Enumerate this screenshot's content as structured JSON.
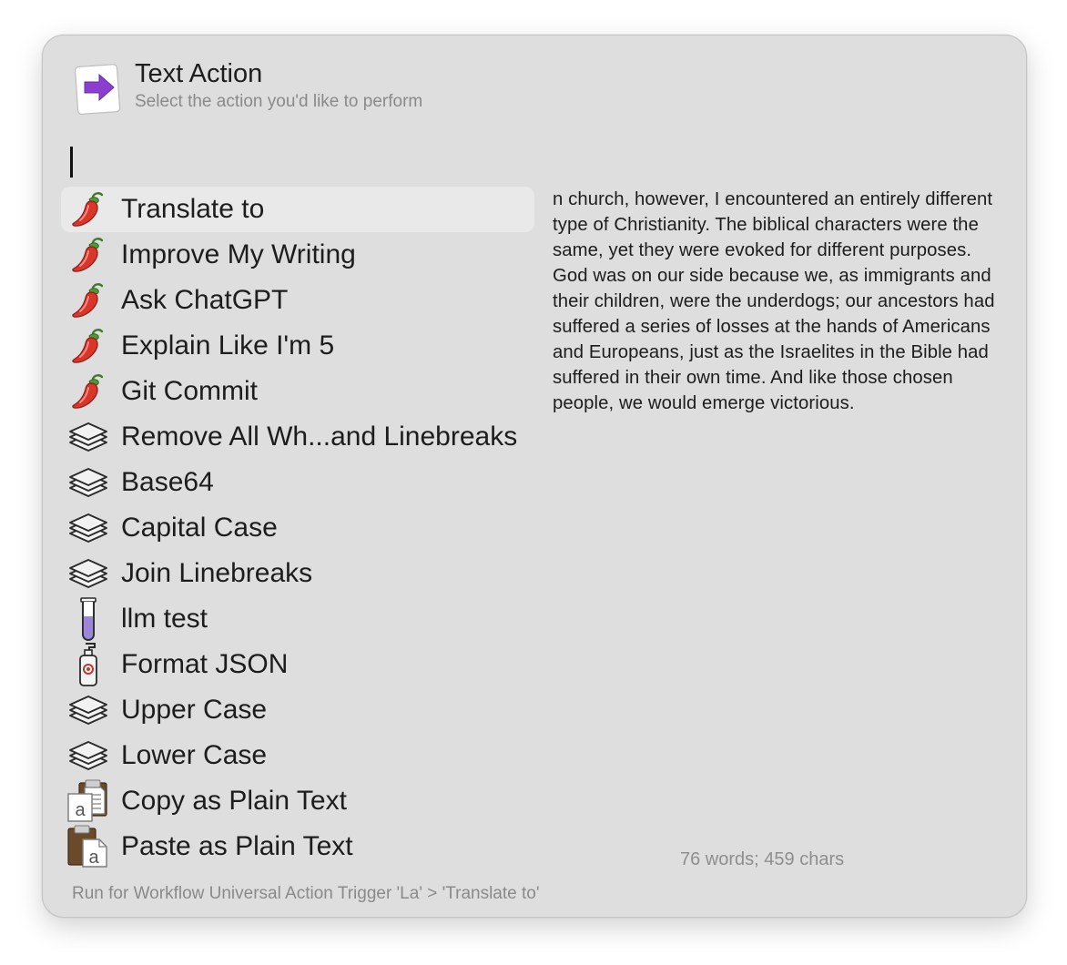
{
  "header": {
    "title": "Text Action",
    "subtitle": "Select the action you'd like to perform",
    "icon": "purple-arrow-right-icon"
  },
  "search": {
    "value": "",
    "placeholder": ""
  },
  "actions": [
    {
      "label": "Translate to",
      "icon": "chili-pepper-icon",
      "selected": true
    },
    {
      "label": "Improve My Writing",
      "icon": "chili-pepper-icon"
    },
    {
      "label": "Ask ChatGPT",
      "icon": "chili-pepper-icon"
    },
    {
      "label": "Explain Like I'm 5",
      "icon": "chili-pepper-icon"
    },
    {
      "label": "Git Commit",
      "icon": "chili-pepper-icon"
    },
    {
      "label": "Remove All Wh...and Linebreaks",
      "icon": "layers-icon"
    },
    {
      "label": "Base64",
      "icon": "layers-icon"
    },
    {
      "label": "Capital Case",
      "icon": "layers-icon"
    },
    {
      "label": "Join Linebreaks",
      "icon": "layers-icon"
    },
    {
      "label": "llm test",
      "icon": "test-tube-icon"
    },
    {
      "label": "Format JSON",
      "icon": "soap-dispenser-icon"
    },
    {
      "label": "Upper Case",
      "icon": "layers-icon"
    },
    {
      "label": "Lower Case",
      "icon": "layers-icon"
    },
    {
      "label": "Copy as Plain Text",
      "icon": "clipboard-copy-icon"
    },
    {
      "label": "Paste as Plain Text",
      "icon": "clipboard-paste-icon"
    }
  ],
  "preview": {
    "text": "n church, however, I encountered an entirely different type of Christianity. The biblical characters were the same, yet they were evoked for different purposes. God was on our side because we, as immigrants and their children, were the underdogs; our ancestors had suffered a series of losses at the hands of Americans and Europeans, just as the Israelites in the Bible had suffered in their own time. And like those chosen people, we would emerge victorious.",
    "stats": "76 words; 459 chars"
  },
  "footer": {
    "text": "Run for Workflow Universal Action Trigger 'La' > 'Translate to'"
  },
  "colors": {
    "window_bg": "#dedede",
    "selection_bg": "#e9e9e9",
    "arrow_purple": "#8a3fd0",
    "chili_red": "#d8342a"
  }
}
